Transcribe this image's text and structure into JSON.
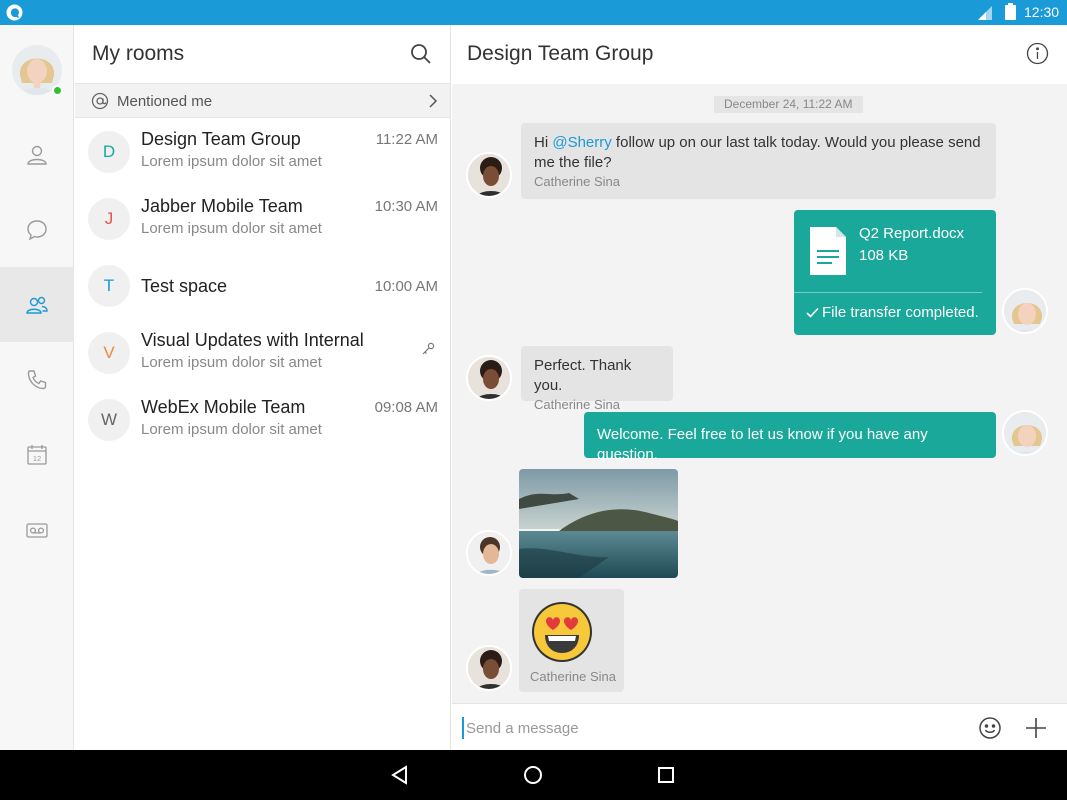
{
  "statusbar": {
    "time": "12:30"
  },
  "rail": {
    "items": [
      {
        "icon": "person-icon"
      },
      {
        "icon": "chat-bubble-icon"
      },
      {
        "icon": "people-icon",
        "active": true
      },
      {
        "icon": "phone-icon"
      },
      {
        "icon": "calendar-icon",
        "badge": "12"
      },
      {
        "icon": "voicemail-icon"
      }
    ]
  },
  "rooms": {
    "title": "My rooms",
    "mentioned_label": "Mentioned me",
    "list": [
      {
        "letter": "D",
        "letter_color": "#1aa89a",
        "name": "Design Team Group",
        "preview": "Lorem ipsum dolor sit amet",
        "time": "11:22 AM"
      },
      {
        "letter": "J",
        "letter_color": "#e2574c",
        "name": "Jabber Mobile Team",
        "preview": "Lorem ipsum dolor sit amet",
        "time": "10:30 AM"
      },
      {
        "letter": "T",
        "letter_color": "#1a9ad6",
        "name": "Test space",
        "preview": "",
        "time": "10:00 AM"
      },
      {
        "letter": "V",
        "letter_color": "#f0883a",
        "name": "Visual Updates with Internal",
        "preview": "Lorem ipsum dolor sit amet",
        "time": ""
      },
      {
        "letter": "W",
        "letter_color": "#666666",
        "name": "WebEx Mobile Team",
        "preview": "Lorem ipsum dolor sit amet",
        "time": "09:08 AM"
      }
    ]
  },
  "chat": {
    "title": "Design Team Group",
    "date": "December 24, 11:22 AM",
    "msg1": {
      "prefix": "Hi ",
      "mention": "@Sherry",
      "rest": " follow up on our last talk today. Would you please send",
      "line2": "me the file?",
      "sender": "Catherine Sina"
    },
    "file": {
      "name": "Q2 Report.docx",
      "size": "108 KB",
      "status": "File transfer completed."
    },
    "msg2": {
      "text": "Perfect. Thank you.",
      "sender": "Catherine Sina"
    },
    "msg3": {
      "text": "Welcome. Feel free to let us know if you have any question."
    },
    "sticker_sender": "Catherine Sina",
    "composer_placeholder": "Send a message"
  },
  "colors": {
    "brand": "#1a9ad6",
    "accent": "#1aa89a",
    "presence": "#2fc32f"
  }
}
